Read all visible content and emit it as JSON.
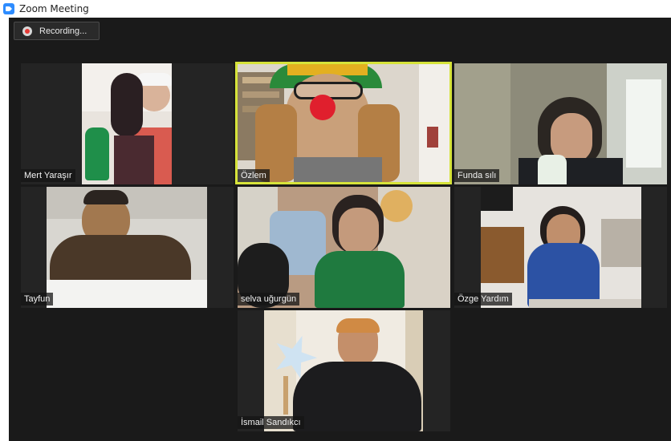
{
  "window": {
    "title": "Zoom Meeting"
  },
  "recording": {
    "label": "Recording..."
  },
  "participants": [
    {
      "name": "Mert Yaraşır"
    },
    {
      "name": "Özlem",
      "active_speaker": true
    },
    {
      "name": "Funda sılı"
    },
    {
      "name": "Tayfun"
    },
    {
      "name": "selva uğurgün"
    },
    {
      "name": "Özge Yardım"
    },
    {
      "name": "İsmail Sandıkcı"
    }
  ],
  "colors": {
    "active_speaker_border": "#d6e33a",
    "meeting_background": "#1a1a1a",
    "app_icon": "#2d8cff",
    "recording_dot": "#e53935"
  }
}
